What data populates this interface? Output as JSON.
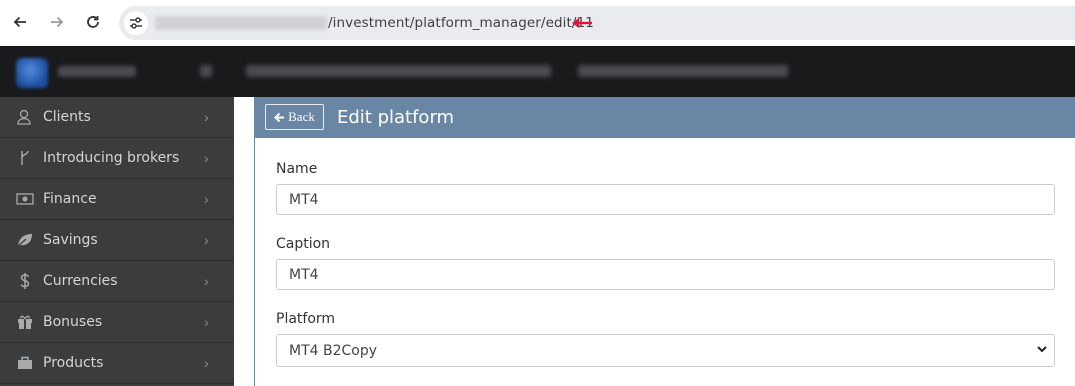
{
  "browser": {
    "back_icon": "arrow-left-icon",
    "forward_icon": "arrow-right-icon",
    "reload_icon": "reload-icon",
    "site_info_icon": "tune-icon",
    "url_path": "/investment/platform_manager/edit/11",
    "annotation_color": "#e0163a"
  },
  "sidebar": {
    "items": [
      {
        "label": "Clients",
        "icon": "clients-icon"
      },
      {
        "label": "Introducing brokers",
        "icon": "branch-icon"
      },
      {
        "label": "Finance",
        "icon": "money-icon"
      },
      {
        "label": "Savings",
        "icon": "leaf-icon"
      },
      {
        "label": "Currencies",
        "icon": "dollar-icon"
      },
      {
        "label": "Bonuses",
        "icon": "gift-icon"
      },
      {
        "label": "Products",
        "icon": "briefcase-icon"
      }
    ]
  },
  "panel": {
    "back_label": "Back",
    "title": "Edit platform",
    "header_color": "#6a86a5"
  },
  "form": {
    "name_label": "Name",
    "name_value": "MT4",
    "caption_label": "Caption",
    "caption_value": "MT4",
    "platform_label": "Platform",
    "platform_selected": "MT4 B2Copy"
  }
}
